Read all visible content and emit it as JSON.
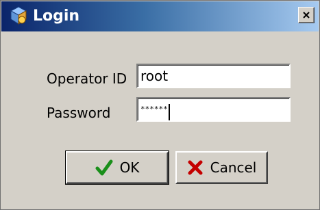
{
  "window": {
    "title": "Login"
  },
  "form": {
    "operator_label": "Operator ID",
    "operator_value": "root",
    "password_label": "Password",
    "password_value": "******"
  },
  "buttons": {
    "ok_label": "OK",
    "cancel_label": "Cancel"
  },
  "icons": {
    "app": "app-icon",
    "close": "close-icon",
    "ok": "checkmark-icon",
    "cancel": "red-x-icon"
  },
  "colors": {
    "titlebar_start": "#0a246a",
    "titlebar_end": "#a6caf0",
    "ok_icon": "#1a8f1a",
    "cancel_icon": "#c40000"
  }
}
